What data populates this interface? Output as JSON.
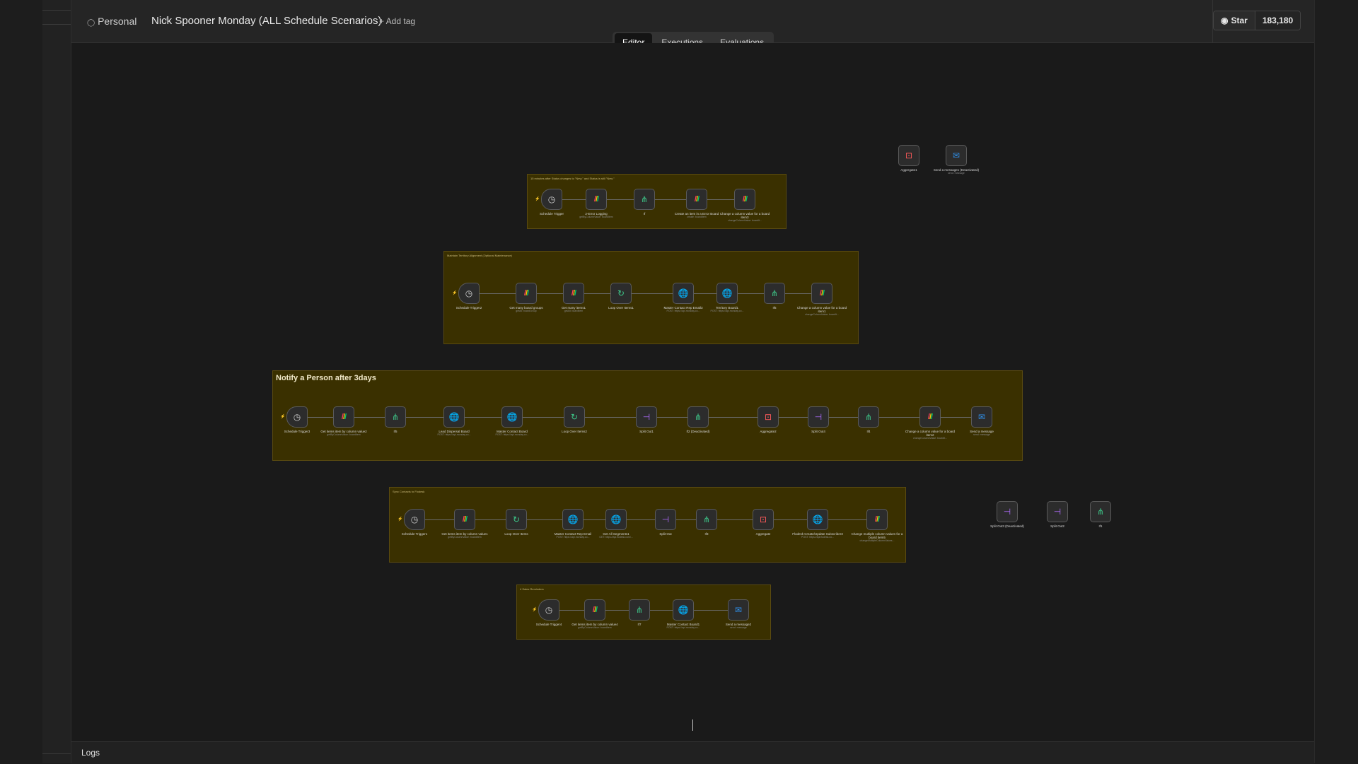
{
  "header": {
    "owner": "Personal",
    "workflow_title": "Nick Spooner Monday (ALL Schedule Scenarios)",
    "add_tag": "+ Add tag",
    "github_star": "Star",
    "github_count": "183,180"
  },
  "tabs": [
    "Editor",
    "Executions",
    "Evaluations"
  ],
  "active_tab": "Editor",
  "logs_label": "Logs",
  "colors": {
    "sticky_bg": "#3a3000",
    "canvas_bg": "#1a1a1a",
    "accent": "#e8712a"
  },
  "groups": [
    {
      "label": "15 minutes after Status changes to \"New,\" and Status is still \"New.\"",
      "nodes": [
        {
          "name": "Schedule Trigger",
          "sub": "",
          "icon": "clock"
        },
        {
          "name": "2-Error Logging",
          "sub": "getByColumnValue: boardItem",
          "icon": "monday"
        },
        {
          "name": "If",
          "sub": "",
          "icon": "if"
        },
        {
          "name": "Create an item in a Error Board",
          "sub": "create: boardItem",
          "icon": "monday"
        },
        {
          "name": "Change a column value for a board item3",
          "sub": "changeColumnValue: boardIt...",
          "icon": "monday"
        }
      ]
    },
    {
      "label": "Maintain Territory Alignment (Optional Maintenance)",
      "nodes": [
        {
          "name": "Schedule Trigger2",
          "sub": "",
          "icon": "clock"
        },
        {
          "name": "Get many board groups",
          "sub": "getAll: boardGroup",
          "icon": "monday"
        },
        {
          "name": "Get many items1",
          "sub": "getAll: boardItem",
          "icon": "monday"
        },
        {
          "name": "Loop Over Items1",
          "sub": "",
          "icon": "loop"
        },
        {
          "name": "Master Contact Rep Email3",
          "sub": "POST: https://api.monday.co...",
          "icon": "globe"
        },
        {
          "name": "Territory Board1",
          "sub": "POST: https://api.monday.co...",
          "icon": "globe"
        },
        {
          "name": "If6",
          "sub": "",
          "icon": "if"
        },
        {
          "name": "Change a column value for a board item1",
          "sub": "changeColumnValue: boardIt...",
          "icon": "monday"
        }
      ]
    },
    {
      "label": "Notify a Person after 3days",
      "nodes": [
        {
          "name": "Schedule Trigger3",
          "sub": "",
          "icon": "clock"
        },
        {
          "name": "Get items item by column value2",
          "sub": "getByColumnValue: boardItem",
          "icon": "monday"
        },
        {
          "name": "If5",
          "sub": "",
          "icon": "if"
        },
        {
          "name": "Lead Dispersal Board",
          "sub": "POST: https://api.monday.co...",
          "icon": "globe"
        },
        {
          "name": "Master Contact Board",
          "sub": "POST: https://api.monday.co...",
          "icon": "globe"
        },
        {
          "name": "Loop Over Items2",
          "sub": "",
          "icon": "loop"
        },
        {
          "name": "Split Out1",
          "sub": "",
          "icon": "split"
        },
        {
          "name": "If2 (Deactivated)",
          "sub": "",
          "icon": "if"
        },
        {
          "name": "Aggregate2",
          "sub": "",
          "icon": "agg"
        },
        {
          "name": "Split Out4",
          "sub": "",
          "icon": "split"
        },
        {
          "name": "If4",
          "sub": "",
          "icon": "if"
        },
        {
          "name": "Change a column value for a board item2",
          "sub": "changeColumnValue: boardIt...",
          "icon": "monday"
        },
        {
          "name": "Send a message",
          "sub": "send: message",
          "icon": "outlook"
        }
      ]
    },
    {
      "label": "Sync Contacts to Flodesk",
      "nodes": [
        {
          "name": "Schedule Trigger1",
          "sub": "",
          "icon": "clock"
        },
        {
          "name": "Get items item by column value1",
          "sub": "getByColumnValue: boardItem",
          "icon": "monday"
        },
        {
          "name": "Loop Over Items",
          "sub": "",
          "icon": "loop"
        },
        {
          "name": "Master Contact Rep Email",
          "sub": "POST: https://api.monday.co...",
          "icon": "globe"
        },
        {
          "name": "Get All Segments1",
          "sub": "GET: https://api.flodesk.com/...",
          "icon": "globe"
        },
        {
          "name": "Split Out",
          "sub": "",
          "icon": "split"
        },
        {
          "name": "If3",
          "sub": "",
          "icon": "if"
        },
        {
          "name": "Aggregate",
          "sub": "",
          "icon": "agg"
        },
        {
          "name": "Flodesk Create/Update Subscriber3",
          "sub": "POST: https://api.flodesk.co...",
          "icon": "globe"
        },
        {
          "name": "Change multiple column values for a board item5",
          "sub": "changeMultipleColumnValues...",
          "icon": "monday"
        }
      ]
    },
    {
      "label": "4 Sales Reminders",
      "nodes": [
        {
          "name": "Schedule Trigger4",
          "sub": "",
          "icon": "clock"
        },
        {
          "name": "Get items item by column value4",
          "sub": "getByColumnValue: boardItem",
          "icon": "monday"
        },
        {
          "name": "If7",
          "sub": "",
          "icon": "if"
        },
        {
          "name": "Master Contact Board1",
          "sub": "POST: https://api.monday.co...",
          "icon": "globe"
        },
        {
          "name": "Send a message2",
          "sub": "send: message",
          "icon": "outlook"
        }
      ]
    }
  ],
  "loose_nodes": [
    {
      "name": "Aggregate1",
      "sub": "",
      "icon": "agg"
    },
    {
      "name": "Send a message1 (Deactivated)",
      "sub": "send: message",
      "icon": "outlook"
    },
    {
      "name": "Split Out3 (Deactivated)",
      "sub": "",
      "icon": "split"
    },
    {
      "name": "Split Out2",
      "sub": "",
      "icon": "split"
    },
    {
      "name": "If1",
      "sub": "",
      "icon": "if"
    }
  ]
}
